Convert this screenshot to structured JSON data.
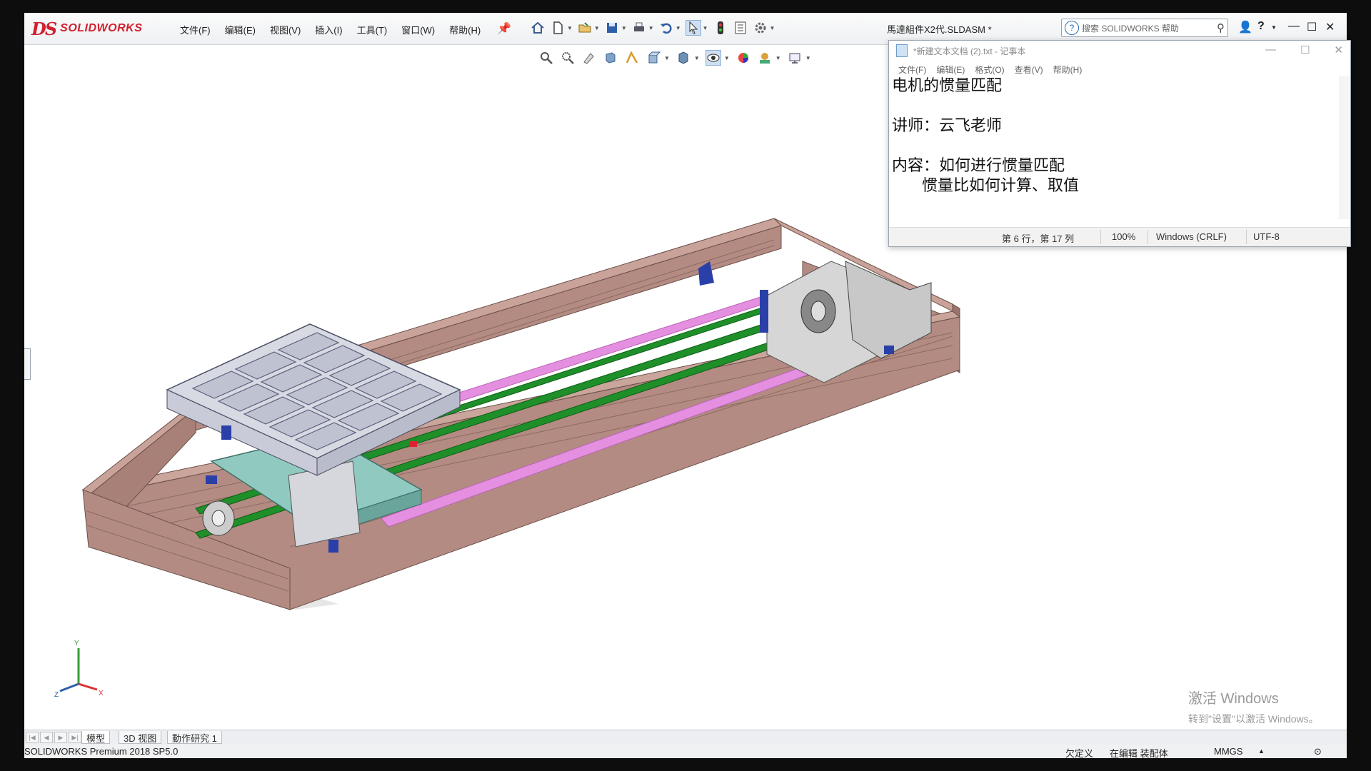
{
  "app": {
    "logo_prefix": "DS",
    "logo_word": "SOLIDWORKS",
    "document_title": "馬達組件X2代.SLDASM *"
  },
  "menu": [
    "文件(F)",
    "编辑(E)",
    "视图(V)",
    "插入(I)",
    "工具(T)",
    "窗口(W)",
    "帮助(H)"
  ],
  "search": {
    "placeholder": "搜索 SOLIDWORKS 帮助"
  },
  "notepad": {
    "title": "*新建文本文档 (2).txt - 记事本",
    "menu": [
      "文件(F)",
      "编辑(E)",
      "格式(O)",
      "查看(V)",
      "帮助(H)"
    ],
    "content": "电机的惯量匹配\n\n讲师：云飞老师\n\n内容：如何进行惯量匹配\n      惯量比如何计算、取值",
    "status": {
      "position": "第 6 行，第 17 列",
      "zoom": "100%",
      "line_ending": "Windows (CRLF)",
      "encoding": "UTF-8"
    }
  },
  "watermark": {
    "line1": "激活 Windows",
    "line2": "转到\"设置\"以激活 Windows。"
  },
  "bottom_tabs": [
    "模型",
    "3D 视图",
    "動作研究 1"
  ],
  "statusbar": {
    "product": "SOLIDWORKS Premium 2018 SP5.0",
    "state1": "欠定义",
    "state2": "在编辑 装配体",
    "units": "MMGS"
  },
  "triad": {
    "x": "X",
    "y": "Y",
    "z": "Z"
  },
  "colors": {
    "frame": "#b38b82",
    "rail_green": "#1f8f2a",
    "rail_pink": "#e58fe0",
    "plate": "#8fc9c0",
    "tray": "#c9ccd8",
    "motor": "#c8c8c8",
    "accent_blue": "#2a3fa8"
  }
}
